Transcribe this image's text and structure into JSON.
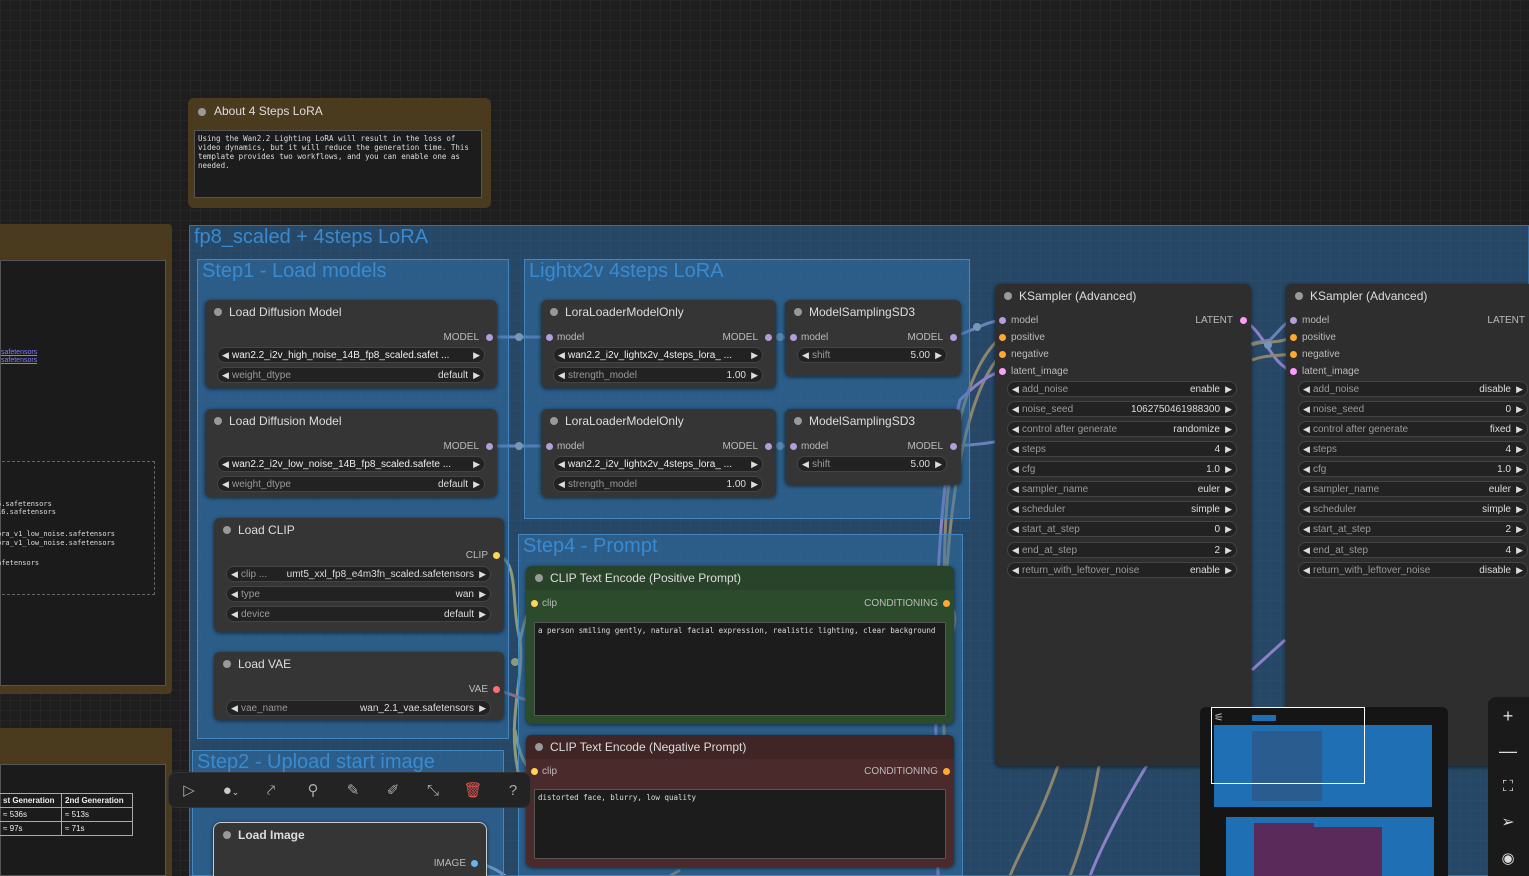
{
  "colors": {
    "group": "#2d69a0",
    "positive": "#2c4a2c",
    "negative": "#4a2a2a",
    "model": "#b39ddb",
    "clip": "#ffd54f",
    "vae": "#ff6e6e",
    "latent": "#ff9cf9",
    "conditioning": "#ffa931",
    "note": "#4a3a1e"
  },
  "note_top": {
    "title": "About 4 Steps LoRA",
    "text": "Using the Wan2.2 Lighting LoRA will result in the loss of video dynamics, but it will reduce the generation time. This template provides two workflows, and you can enable one as needed."
  },
  "left_partial": {
    "links": [
      "safetensors",
      "safetensors"
    ],
    "files": [
      "5.safetensors",
      "16.safetensors",
      "ora_v1_low_noise.safetensors",
      "ora_v1_low_noise.safetensors",
      "afetensors"
    ],
    "table_headers": [
      "st Generation",
      "2nd Generation"
    ],
    "table_rows": [
      [
        "≈ 536s",
        "≈ 513s"
      ],
      [
        "≈ 97s",
        "≈ 71s"
      ]
    ]
  },
  "group_main": {
    "title": "fp8_scaled +  4steps LoRA"
  },
  "step1": {
    "title": "Step1 - Load models"
  },
  "lora_group": {
    "title": "Lightx2v 4steps LoRA"
  },
  "step4": {
    "title": "Step4 -  Prompt"
  },
  "step2": {
    "title": "Step2 - Upload start  image"
  },
  "ldm1": {
    "title": "Load Diffusion Model",
    "out": "MODEL",
    "unet": "wan2.2_i2v_high_noise_14B_fp8_scaled.safet ...",
    "dtype_label": "weight_dtype",
    "dtype": "default"
  },
  "ldm2": {
    "title": "Load Diffusion Model",
    "out": "MODEL",
    "unet": "wan2.2_i2v_low_noise_14B_fp8_scaled.safete ...",
    "dtype_label": "weight_dtype",
    "dtype": "default"
  },
  "lora1": {
    "title": "LoraLoaderModelOnly",
    "in": "model",
    "out": "MODEL",
    "name": "wan2.2_i2v_lightx2v_4steps_lora_ ...",
    "str_label": "strength_model",
    "str": "1.00"
  },
  "lora2": {
    "title": "LoraLoaderModelOnly",
    "in": "model",
    "out": "MODEL",
    "name": "wan2.2_i2v_lightx2v_4steps_lora_ ...",
    "str_label": "strength_model",
    "str": "1.00"
  },
  "msd1": {
    "title": "ModelSamplingSD3",
    "in": "model",
    "out": "MODEL",
    "shift_label": "shift",
    "shift": "5.00"
  },
  "msd2": {
    "title": "ModelSamplingSD3",
    "in": "model",
    "out": "MODEL",
    "shift_label": "shift",
    "shift": "5.00"
  },
  "clip": {
    "title": "Load CLIP",
    "out": "CLIP",
    "name_label": "clip ...",
    "name": "umt5_xxl_fp8_e4m3fn_scaled.safetensors",
    "type_label": "type",
    "type": "wan",
    "device_label": "device",
    "device": "default"
  },
  "vae": {
    "title": "Load VAE",
    "out": "VAE",
    "name_label": "vae_name",
    "name": "wan_2.1_vae.safetensors"
  },
  "pos": {
    "title": "CLIP Text Encode (Positive Prompt)",
    "in": "clip",
    "out": "CONDITIONING",
    "text": "a person smiling gently, natural facial expression, realistic lighting, clear background"
  },
  "neg": {
    "title": "CLIP Text Encode (Negative Prompt)",
    "in": "clip",
    "out": "CONDITIONING",
    "text": "distorted face, blurry, low quality"
  },
  "loadimg": {
    "title": "Load Image",
    "out": "IMAGE"
  },
  "ks1": {
    "title": "KSampler (Advanced)",
    "inputs": [
      "model",
      "positive",
      "negative",
      "latent_image"
    ],
    "out": "LATENT",
    "widgets": [
      [
        "add_noise",
        "enable"
      ],
      [
        "noise_seed",
        "1062750461988300"
      ],
      [
        "control after generate",
        "randomize"
      ],
      [
        "steps",
        "4"
      ],
      [
        "cfg",
        "1.0"
      ],
      [
        "sampler_name",
        "euler"
      ],
      [
        "scheduler",
        "simple"
      ],
      [
        "start_at_step",
        "0"
      ],
      [
        "end_at_step",
        "2"
      ],
      [
        "return_with_leftover_noise",
        "enable"
      ]
    ]
  },
  "ks2": {
    "title": "KSampler (Advanced)",
    "inputs": [
      "model",
      "positive",
      "negative",
      "latent_image"
    ],
    "out": "LATENT",
    "widgets": [
      [
        "add_noise",
        "disable"
      ],
      [
        "noise_seed",
        "0"
      ],
      [
        "control after generate",
        "fixed"
      ],
      [
        "steps",
        "4"
      ],
      [
        "cfg",
        "1.0"
      ],
      [
        "sampler_name",
        "euler"
      ],
      [
        "scheduler",
        "simple"
      ],
      [
        "start_at_step",
        "2"
      ],
      [
        "end_at_step",
        "4"
      ],
      [
        "return_with_leftover_noise",
        "disable"
      ]
    ]
  },
  "toolbar": {
    "icons": [
      "play-icon",
      "color-circle-icon",
      "bypass-icon",
      "pin-icon",
      "edit-icon",
      "pencil-icon",
      "collapse-icon",
      "delete-icon",
      "help-icon"
    ]
  },
  "right_tools": {
    "icons": [
      "zoom-in-icon",
      "zoom-out-icon",
      "fit-view-icon",
      "navigate-icon",
      "visibility-icon"
    ]
  }
}
